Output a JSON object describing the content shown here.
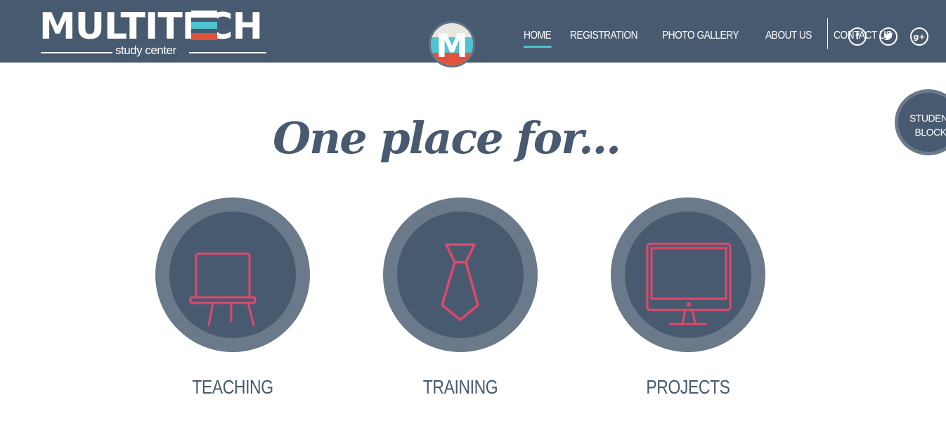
{
  "header": {
    "logo": {
      "wordmark": "MULTITECH",
      "tagline": "study center"
    },
    "badge_letter": "M",
    "nav": [
      {
        "label": "HOME",
        "active": true
      },
      {
        "label": "REGISTRATION",
        "active": false
      },
      {
        "label": "PHOTO GALLERY",
        "active": false
      },
      {
        "label": "ABOUT US",
        "active": false
      },
      {
        "label": "CONTACT US",
        "active": false
      }
    ],
    "social": {
      "facebook": {
        "icon": "facebook-icon",
        "glyph": "f"
      },
      "twitter": {
        "icon": "twitter-icon",
        "glyph": "t"
      },
      "googleplus": {
        "icon": "google-plus-icon",
        "glyph": "g+"
      }
    }
  },
  "student_block": {
    "label": "STUDENT BLOCK"
  },
  "main": {
    "tagline": "One place for...",
    "features": [
      {
        "label": "TEACHING",
        "icon": "whiteboard-easel-icon"
      },
      {
        "label": "TRAINING",
        "icon": "necktie-icon"
      },
      {
        "label": "PROJECTS",
        "icon": "monitor-icon"
      }
    ]
  },
  "colors": {
    "header_bg": "#485a70",
    "ring": "#6b7a8b",
    "icon_stroke": "#e0486a",
    "accent_cyan": "#4fc3cf",
    "accent_red": "#e0533d"
  }
}
